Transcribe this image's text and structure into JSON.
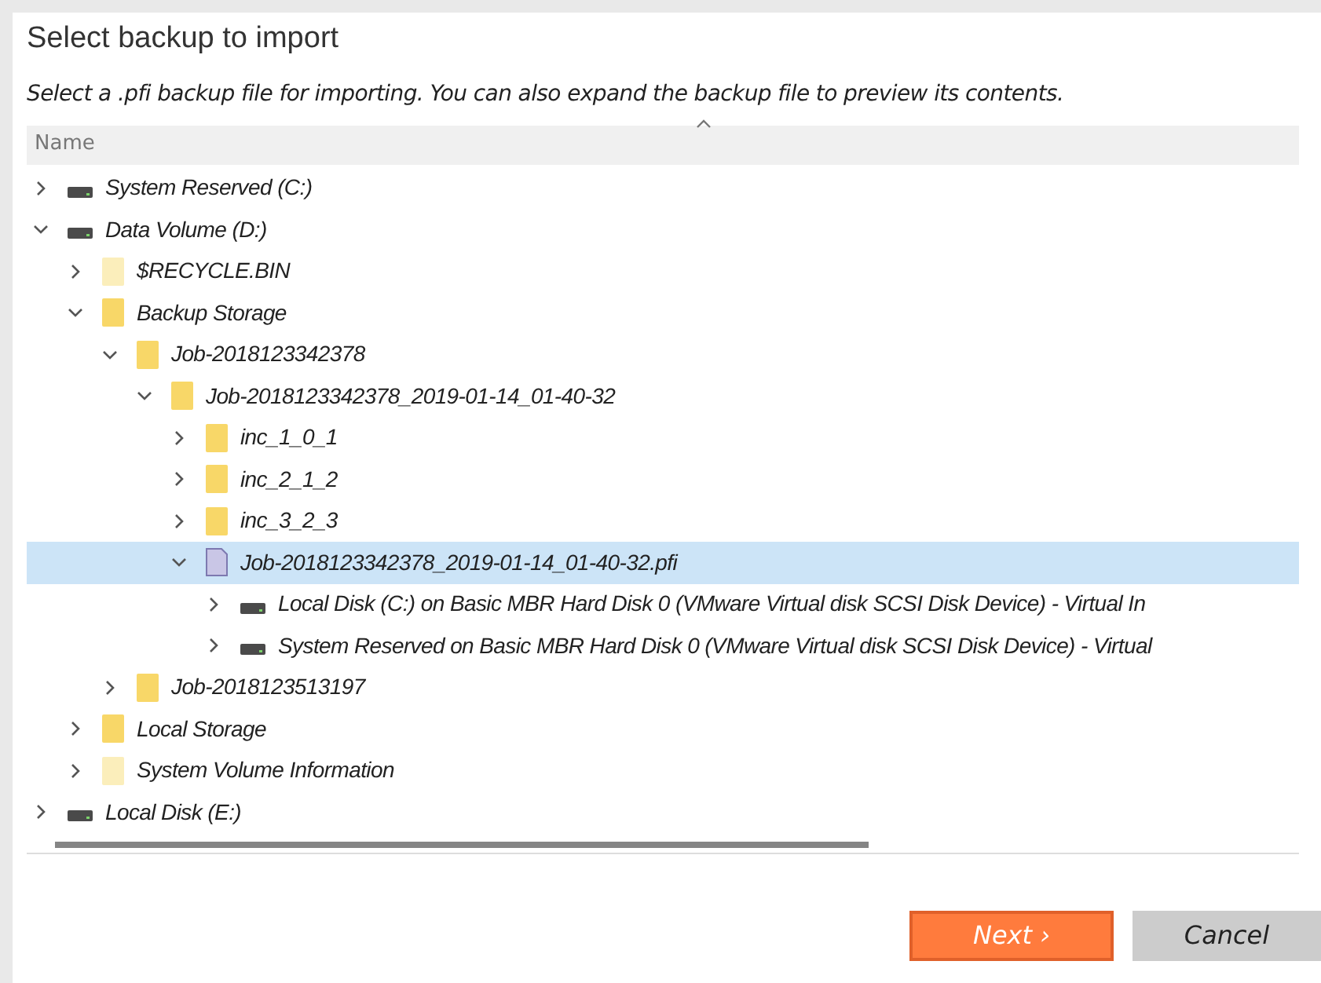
{
  "dialog": {
    "title": "Select backup to import",
    "description": "Select a .pfi backup file for importing. You can also expand the backup file to preview its contents."
  },
  "table": {
    "columns": [
      {
        "label": "Name"
      }
    ]
  },
  "tree": [
    {
      "label": "System Reserved (C:)",
      "kind": "drive",
      "expanded": false,
      "selected": false
    },
    {
      "label": "Data Volume (D:)",
      "kind": "drive",
      "expanded": true,
      "selected": false,
      "children": [
        {
          "label": "$RECYCLE.BIN",
          "kind": "folder",
          "hidden": true,
          "expanded": false,
          "selected": false
        },
        {
          "label": "Backup Storage",
          "kind": "folder",
          "hidden": false,
          "expanded": true,
          "selected": false,
          "children": [
            {
              "label": "Job-2018123342378",
              "kind": "folder",
              "hidden": false,
              "expanded": true,
              "selected": false,
              "children": [
                {
                  "label": "Job-2018123342378_2019-01-14_01-40-32",
                  "kind": "folder",
                  "hidden": false,
                  "expanded": true,
                  "selected": false,
                  "children": [
                    {
                      "label": "inc_1_0_1",
                      "kind": "folder",
                      "hidden": false,
                      "expanded": false,
                      "selected": false
                    },
                    {
                      "label": "inc_2_1_2",
                      "kind": "folder",
                      "hidden": false,
                      "expanded": false,
                      "selected": false
                    },
                    {
                      "label": "inc_3_2_3",
                      "kind": "folder",
                      "hidden": false,
                      "expanded": false,
                      "selected": false
                    },
                    {
                      "label": "Job-2018123342378_2019-01-14_01-40-32.pfi",
                      "kind": "file",
                      "expanded": true,
                      "selected": true,
                      "children": [
                        {
                          "label": "Local Disk (C:) on Basic MBR Hard Disk 0 (VMware Virtual disk SCSI Disk Device) - Virtual In",
                          "kind": "drive",
                          "expanded": false,
                          "selected": false
                        },
                        {
                          "label": "System Reserved on Basic MBR Hard Disk 0 (VMware Virtual disk SCSI Disk Device) - Virtual",
                          "kind": "drive",
                          "expanded": false,
                          "selected": false
                        }
                      ]
                    }
                  ]
                }
              ]
            },
            {
              "label": "Job-2018123513197",
              "kind": "folder",
              "hidden": false,
              "expanded": false,
              "selected": false
            }
          ]
        },
        {
          "label": "Local Storage",
          "kind": "folder",
          "hidden": false,
          "expanded": false,
          "selected": false
        },
        {
          "label": "System Volume Information",
          "kind": "folder",
          "hidden": true,
          "expanded": false,
          "selected": false
        }
      ]
    },
    {
      "label": "Local Disk (E:)",
      "kind": "drive",
      "expanded": false,
      "selected": false
    }
  ],
  "buttons": [
    {
      "label": "Next ›",
      "kind": "primary"
    },
    {
      "label": "Cancel",
      "kind": "secondary"
    }
  ]
}
